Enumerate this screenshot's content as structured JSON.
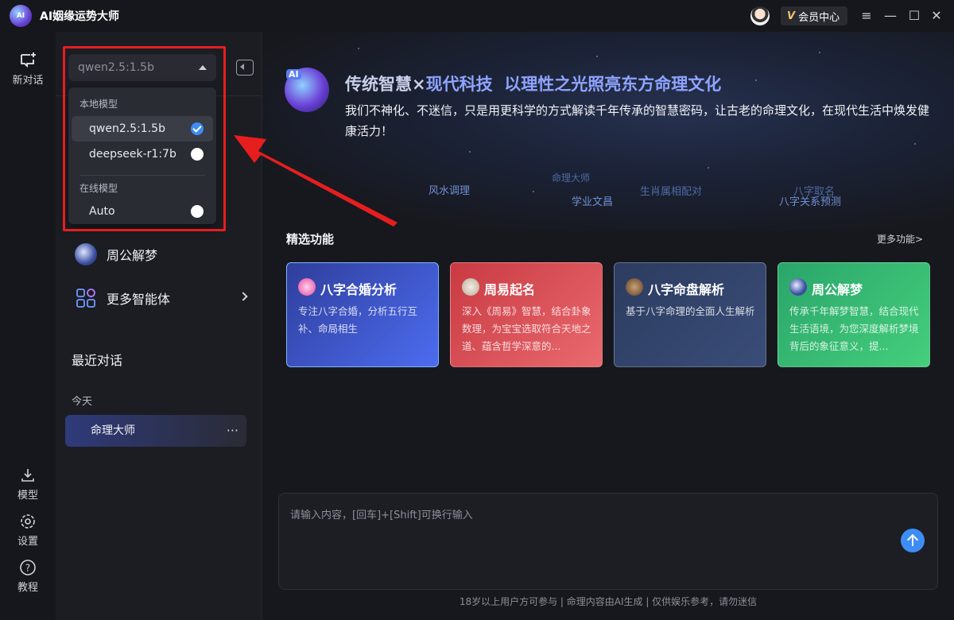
{
  "app": {
    "logo_text": "AI",
    "title": "AI姻缘运势大师",
    "vip_label": "会员中心",
    "vip_mark": "V"
  },
  "rail": {
    "new_chat": "新对话",
    "model": "模型",
    "settings": "设置",
    "tutorial": "教程"
  },
  "model_select": {
    "current": "qwen2.5:1.5b",
    "groups": [
      {
        "label": "本地模型",
        "items": [
          {
            "label": "qwen2.5:1.5b",
            "selected": true
          },
          {
            "label": "deepseek-r1:7b",
            "selected": false
          }
        ]
      },
      {
        "label": "在线模型",
        "items": [
          {
            "label": "Auto",
            "selected": false
          }
        ]
      }
    ]
  },
  "sidebar": {
    "links": [
      {
        "label": "周公解梦"
      },
      {
        "label": "更多智能体"
      }
    ],
    "recent_title": "最近对话",
    "today": "今天",
    "chats": [
      {
        "label": "命理大师",
        "more": "···"
      }
    ]
  },
  "hero": {
    "logo_text": "AI",
    "title_part1": "传统智慧",
    "title_sep": "×",
    "title_part2": "现代科技",
    "title_part3": "以理性之光照亮东方命理文化",
    "description": "我们不神化、不迷信，只是用更科学的方式解读千年传承的智慧密码，让古老的命理文化，在现代生活中焕发健康活力！",
    "tags": [
      "风水调理",
      "命理大师",
      "学业文昌",
      "生肖属相配对",
      "八字取名",
      "八字关系预测"
    ]
  },
  "features": {
    "title": "精选功能",
    "more": "更多功能>",
    "cards": [
      {
        "title": "八字合婚分析",
        "desc": "专注八字合婚，分析五行互补、命局相生",
        "bg": "#3b4fb8",
        "icon": "heart-icon"
      },
      {
        "title": "周易起名",
        "desc": "深入《周易》智慧，结合卦象数理，为宝宝选取符合天地之道、蕴含哲学深意的...",
        "bg": "#d9484f",
        "icon": "book-icon"
      },
      {
        "title": "八字命盘解析",
        "desc": "基于八字命理的全面人生解析",
        "bg": "#33456e",
        "icon": "compass-icon"
      },
      {
        "title": "周公解梦",
        "desc": "传承千年解梦智慧，结合现代生活语境，为您深度解析梦境背后的象征意义，提...",
        "bg": "#2fb573",
        "icon": "moon-icon"
      }
    ]
  },
  "input": {
    "placeholder": "请输入内容，[回车]+[Shift]可换行输入"
  },
  "footer": "18岁以上用户方可参与 | 命理内容由AI生成 | 仅供娱乐参考，请勿迷信"
}
